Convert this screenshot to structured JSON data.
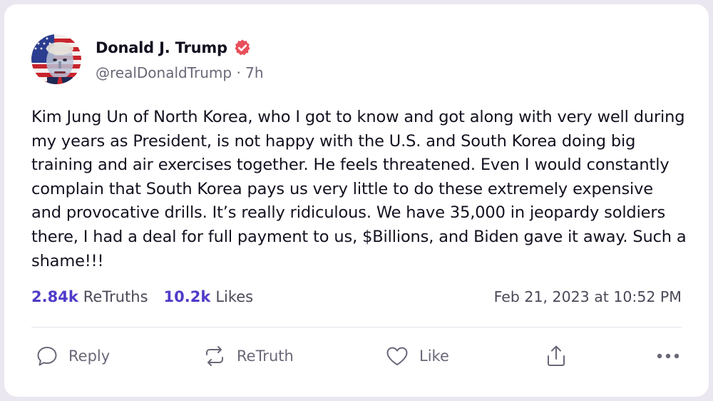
{
  "post": {
    "author": {
      "display_name": "Donald J. Trump",
      "handle": "@realDonaldTrump",
      "separator": "·",
      "age": "7h"
    },
    "body": "Kim Jung Un of North Korea, who I got to know and got along with very well during my years as President, is not happy with the U.S. and South Korea doing big training and air exercises together. He feels threatened. Even I would constantly complain that South Korea pays us very little to do these extremely expensive and provocative drills. It’s really ridiculous. We have 35,000 in jeopardy soldiers there, I had a deal for full payment to us, $Billions, and Biden gave it away. Such a shame!!!",
    "stats": {
      "retruths_count": "2.84k",
      "retruths_label": "ReTruths",
      "likes_count": "10.2k",
      "likes_label": "Likes"
    },
    "timestamp": "Feb 21, 2023 at 10:52 PM"
  },
  "actions": {
    "reply_label": "Reply",
    "retruth_label": "ReTruth",
    "like_label": "Like"
  },
  "icons": {
    "verified": "verified-badge-icon",
    "reply": "speech-bubble-icon",
    "retruth": "repost-arrows-icon",
    "like": "heart-icon",
    "share": "share-upload-icon",
    "more": "more-dots-icon"
  },
  "colors": {
    "accent": "#4f3cc9",
    "verified": "#e8505b",
    "text": "#14101f",
    "muted": "#6b6777",
    "background": "#ebe7f1"
  }
}
